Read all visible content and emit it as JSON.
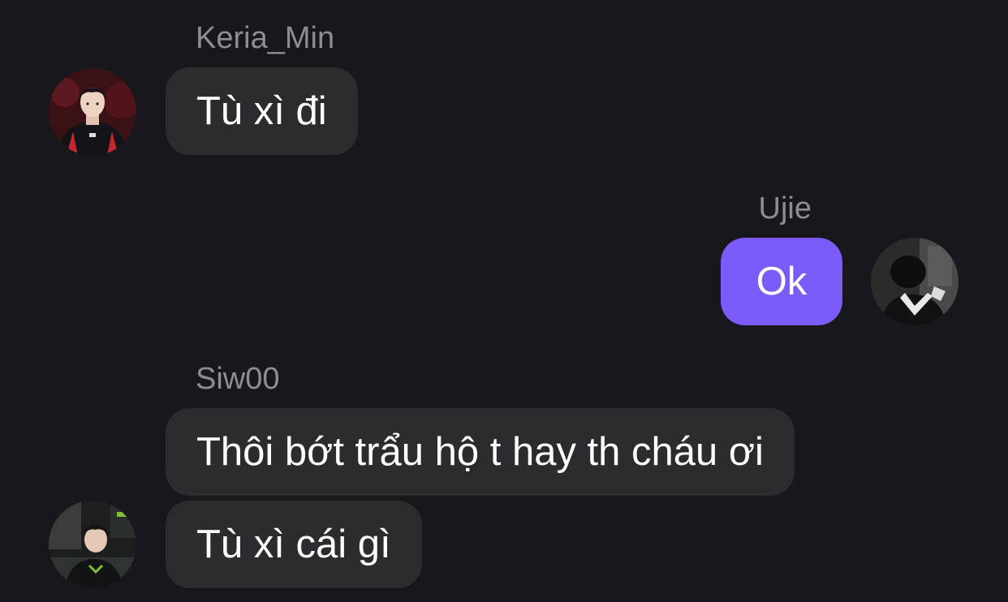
{
  "messages": [
    {
      "sender": "Keria_Min",
      "avatar_icon": "user-avatar-keria",
      "side": "left",
      "texts": [
        "Tù xì đi"
      ]
    },
    {
      "sender": "Ujie",
      "avatar_icon": "user-avatar-ujie",
      "side": "right",
      "texts": [
        "Ok"
      ]
    },
    {
      "sender": "Siw00",
      "avatar_icon": "user-avatar-siw00",
      "side": "left",
      "texts": [
        "Thôi bớt trẩu hộ t hay th cháu ơi",
        "Tù xì cái gì"
      ]
    }
  ],
  "colors": {
    "background": "#18171c",
    "incoming_bubble": "#2c2c2f",
    "outgoing_bubble": "#7b5cfa",
    "sender_name": "#8e8d93",
    "message_text": "#ffffff"
  }
}
